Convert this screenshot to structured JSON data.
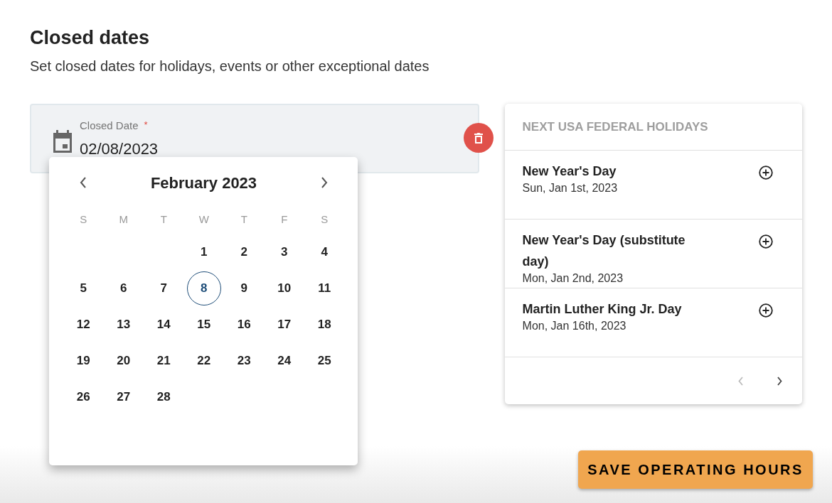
{
  "heading": "Closed dates",
  "subheading": "Set closed dates for holidays, events or other exceptional dates",
  "date_field": {
    "label": "Closed Date",
    "required_mark": "*",
    "value": "02/08/2023"
  },
  "calendar": {
    "month_title": "February 2023",
    "weekdays": [
      "S",
      "M",
      "T",
      "W",
      "T",
      "F",
      "S"
    ],
    "weeks": [
      [
        {
          "label": "1",
          "selected": false
        },
        {
          "label": "2",
          "selected": false
        },
        {
          "label": "3",
          "selected": false
        },
        {
          "label": "4",
          "selected": false
        }
      ],
      [
        {
          "label": "5",
          "selected": false
        },
        {
          "label": "6",
          "selected": false
        },
        {
          "label": "7",
          "selected": false
        },
        {
          "label": "8",
          "selected": true
        },
        {
          "label": "9",
          "selected": false
        },
        {
          "label": "10",
          "selected": false
        },
        {
          "label": "11",
          "selected": false
        }
      ],
      [
        {
          "label": "12",
          "selected": false
        },
        {
          "label": "13",
          "selected": false
        },
        {
          "label": "14",
          "selected": false
        },
        {
          "label": "15",
          "selected": false
        },
        {
          "label": "16",
          "selected": false
        },
        {
          "label": "17",
          "selected": false
        },
        {
          "label": "18",
          "selected": false
        }
      ],
      [
        {
          "label": "19",
          "selected": false
        },
        {
          "label": "20",
          "selected": false
        },
        {
          "label": "21",
          "selected": false
        },
        {
          "label": "22",
          "selected": false
        },
        {
          "label": "23",
          "selected": false
        },
        {
          "label": "24",
          "selected": false
        },
        {
          "label": "25",
          "selected": false
        }
      ],
      [
        {
          "label": "26",
          "selected": false
        },
        {
          "label": "27",
          "selected": false
        },
        {
          "label": "28",
          "selected": false
        }
      ]
    ]
  },
  "holidays": {
    "title": "NEXT USA FEDERAL HOLIDAYS",
    "items": [
      {
        "name": "New Year's Day",
        "date": "Sun, Jan 1st, 2023"
      },
      {
        "name": "New Year's Day (substitute day)",
        "date": "Mon, Jan 2nd, 2023"
      },
      {
        "name": "Martin Luther King Jr. Day",
        "date": "Mon, Jan 16th, 2023"
      }
    ]
  },
  "save_button": "SAVE OPERATING HOURS"
}
